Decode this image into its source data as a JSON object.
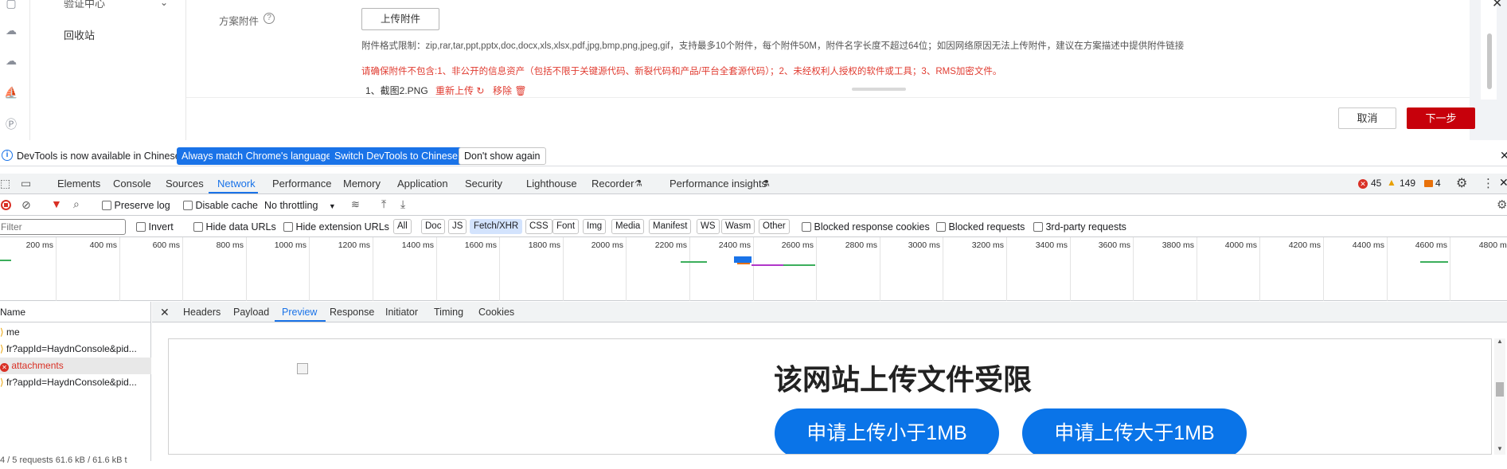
{
  "app": {
    "nav": {
      "verify_center": "验证中心",
      "recycle_bin": "回收站"
    },
    "attach_label": "方案附件",
    "upload_button": "上传附件",
    "format_hint": "附件格式限制：zip,rar,tar,ppt,pptx,doc,docx,xls,xlsx,pdf,jpg,bmp,png,jpeg,gif，支持最多10个附件，每个附件50M，附件名字长度不超过64位；如因网络原因无法上传附件，建议在方案描述中提供附件链接",
    "warning": "请确保附件不包含:1、非公开的信息资产（包括不限于关键源代码、新裂代码和产品/平台全套源代码）；2、未经权利人授权的软件或工具；3、RMS加密文件。",
    "file_item": "1、截图2.PNG",
    "reupload": "重新上传",
    "remove": "移除",
    "cancel": "取消",
    "next": "下一步"
  },
  "infobar": {
    "message": "DevTools is now available in Chinese!",
    "match_btn": "Always match Chrome's language",
    "switch_btn": "Switch DevTools to Chinese",
    "dismiss_btn": "Don't show again"
  },
  "tabs": [
    "Elements",
    "Console",
    "Sources",
    "Network",
    "Performance",
    "Memory",
    "Application",
    "Security",
    "Lighthouse",
    "Recorder",
    "Performance insights"
  ],
  "counters": {
    "errors": "45",
    "warnings": "149",
    "issues": "4"
  },
  "toolbar": {
    "preserve_log": "Preserve log",
    "disable_cache": "Disable cache",
    "throttle": "No throttling"
  },
  "filter": {
    "placeholder": "Filter",
    "invert": "Invert",
    "hide_data": "Hide data URLs",
    "hide_ext": "Hide extension URLs",
    "types": [
      "All",
      "Doc",
      "JS",
      "Fetch/XHR",
      "CSS",
      "Font",
      "Img",
      "Media",
      "Manifest",
      "WS",
      "Wasm",
      "Other"
    ],
    "blocked_cookies": "Blocked response cookies",
    "blocked_requests": "Blocked requests",
    "third_party": "3rd-party requests"
  },
  "timeline": {
    "labels": [
      "200 ms",
      "400 ms",
      "600 ms",
      "800 ms",
      "1000 ms",
      "1200 ms",
      "1400 ms",
      "1600 ms",
      "1800 ms",
      "2000 ms",
      "2200 ms",
      "2400 ms",
      "2600 ms",
      "2800 ms",
      "3000 ms",
      "3200 ms",
      "3400 ms",
      "3600 ms",
      "3800 ms",
      "4000 ms",
      "4200 ms",
      "4400 ms",
      "4600 ms",
      "4800 ms"
    ]
  },
  "requests": {
    "header": "Name",
    "rows": [
      "me",
      "fr?appId=HaydnConsole&pid...",
      "attachments",
      "fr?appId=HaydnConsole&pid..."
    ],
    "summary": "4 / 5 requests    61.6 kB / 61.6 kB t"
  },
  "detail_tabs": [
    "Headers",
    "Payload",
    "Preview",
    "Response",
    "Initiator",
    "Timing",
    "Cookies"
  ],
  "preview": {
    "title": "该网站上传文件受限",
    "btn_small": "申请上传小于1MB",
    "btn_large": "申请上传大于1MB"
  },
  "colors": {
    "brand_red": "#c7000b",
    "devtools_blue": "#1a73e8",
    "error_red": "#d93025"
  }
}
